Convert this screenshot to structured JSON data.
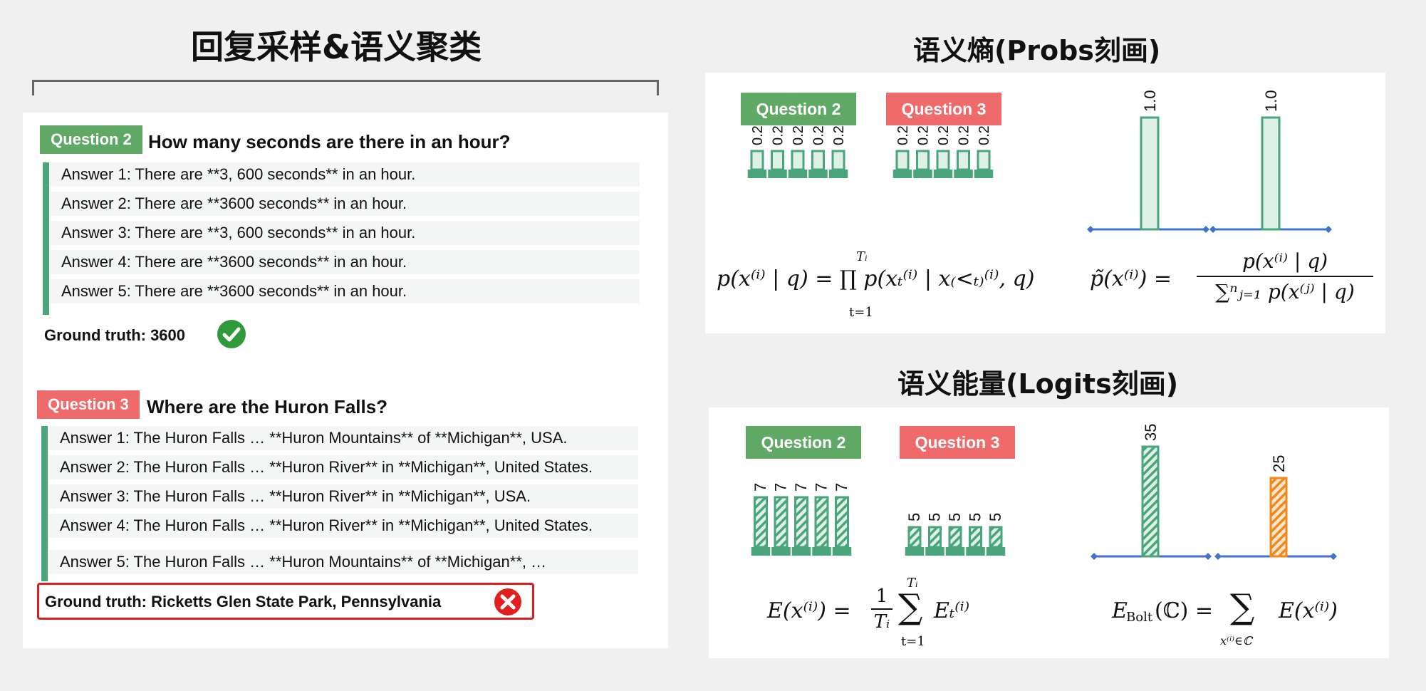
{
  "left": {
    "title": "回复采样&语义聚类",
    "q2": {
      "badge": "Question 2",
      "text": "How many seconds are there in an hour?",
      "answers": [
        "Answer 1: There are **3, 600 seconds** in an hour.",
        "Answer 2: There are **3600 seconds** in an hour.",
        "Answer 3: There are **3, 600 seconds** in an hour.",
        "Answer 4: There are **3600 seconds** in an hour.",
        "Answer 5: There are **3600 seconds** in an hour."
      ],
      "ground_truth": "Ground truth: 3600",
      "status_icon": "check-icon"
    },
    "q3": {
      "badge": "Question 3",
      "text": "Where are the Huron Falls?",
      "answers": [
        "Answer 1: The Huron Falls … **Huron Mountains** of **Michigan**, USA.",
        "Answer 2: The Huron Falls … **Huron River** in **Michigan**, United States.",
        "Answer 3: The Huron Falls … **Huron River** in **Michigan**, USA.",
        "Answer 4: The Huron Falls … **Huron River** in **Michigan**, United States.",
        "Answer 5: The Huron Falls … **Huron Mountains** of **Michigan**, …"
      ],
      "ground_truth": "Ground truth: Ricketts Glen State Park, Pennsylvania",
      "status_icon": "cross-icon"
    }
  },
  "entropy": {
    "title": "语义熵(Probs刻画)",
    "badge_q2": "Question 2",
    "badge_q3": "Question 3",
    "formula_left": "p(x⁽ⁱ⁾ | q) = ∏ p(xₜ⁽ⁱ⁾ | x₍<ₜ₎⁽ⁱ⁾, q)",
    "formula_left_upper": "Tᵢ",
    "formula_left_lower": "t=1",
    "formula_right_lhs": "p̃(x⁽ⁱ⁾) =",
    "formula_right_num": "p(x⁽ⁱ⁾ | q)",
    "formula_right_den": "∑ⁿⱼ₌₁ p(x⁽ʲ⁾ | q)"
  },
  "energy": {
    "title": "语义能量(Logits刻画)",
    "badge_q2": "Question 2",
    "badge_q3": "Question 3",
    "formula_left_lhs": "E(x⁽ⁱ⁾) =",
    "formula_left_frac_num": "1",
    "formula_left_frac_den": "Tᵢ",
    "formula_left_sum_upper": "Tᵢ",
    "formula_left_sum_lower": "t=1",
    "formula_left_rhs": "Eₜ⁽ⁱ⁾",
    "formula_right_lhs": "E",
    "formula_right_sub": "Bolt",
    "formula_right_mid": "(ℂ) =",
    "formula_right_sum_lower": "x⁽ⁱ⁾∈ℂ",
    "formula_right_rhs": "E(x⁽ⁱ⁾)"
  },
  "chart_data": [
    {
      "type": "bar",
      "categories": [
        "1",
        "2",
        "3",
        "4",
        "5"
      ],
      "values": [
        0.2,
        0.2,
        0.2,
        0.2,
        0.2
      ],
      "labels": [
        "0.2",
        "0.2",
        "0.2",
        "0.2",
        "0.2"
      ],
      "style": "plain-green"
    },
    {
      "type": "bar",
      "categories": [
        "1",
        "2",
        "3",
        "4",
        "5"
      ],
      "values": [
        0.2,
        0.2,
        0.2,
        0.2,
        0.2
      ],
      "labels": [
        "0.2",
        "0.2",
        "0.2",
        "0.2",
        "0.2"
      ],
      "style": "plain-green"
    },
    {
      "type": "bar",
      "categories": [
        "1",
        "2"
      ],
      "values": [
        1.0,
        1.0
      ],
      "labels": [
        "1.0",
        "1.0"
      ],
      "style": "plain-green"
    },
    {
      "type": "bar",
      "categories": [
        "1",
        "2",
        "3",
        "4",
        "5"
      ],
      "values": [
        7,
        7,
        7,
        7,
        7
      ],
      "labels": [
        "7",
        "7",
        "7",
        "7",
        "7"
      ],
      "style": "hatched-green"
    },
    {
      "type": "bar",
      "categories": [
        "1",
        "2",
        "3",
        "4",
        "5"
      ],
      "values": [
        5,
        5,
        5,
        5,
        5
      ],
      "labels": [
        "5",
        "5",
        "5",
        "5",
        "5"
      ],
      "style": "hatched-green"
    },
    {
      "type": "bar",
      "categories": [
        "1",
        "2"
      ],
      "values": [
        35,
        25
      ],
      "labels": [
        "35",
        "25"
      ],
      "style": "hatched-green-orange"
    }
  ]
}
